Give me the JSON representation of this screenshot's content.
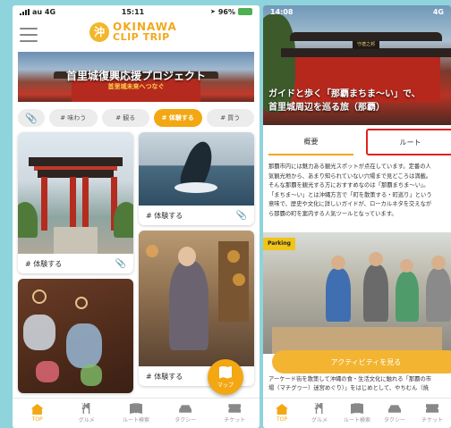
{
  "left": {
    "status": {
      "carrier": "au 4G",
      "time": "15:11",
      "battery": "96%"
    },
    "logo": {
      "line1": "OKINAWA",
      "line2": "CLIP TRIP",
      "mark": "沖"
    },
    "banner": {
      "title": "首里城復興応援プロジェクト",
      "subtitle": "首里城未来へつなぐ"
    },
    "tabs": [
      {
        "label": "📎",
        "icon": "clip-icon"
      },
      {
        "label": "# 味わう"
      },
      {
        "label": "# 観る"
      },
      {
        "label": "# 体験する",
        "active": true
      },
      {
        "label": "# 買う"
      }
    ],
    "cards": [
      {
        "tag": "# 体験する"
      },
      {
        "tag": "# 体験する"
      },
      {
        "tag": "# 体験する"
      }
    ],
    "map_button": "マップ",
    "nav": [
      {
        "label": "TOP",
        "icon": "home-icon",
        "active": true
      },
      {
        "label": "グルメ",
        "icon": "fork-icon"
      },
      {
        "label": "ルート検索",
        "icon": "book-icon"
      },
      {
        "label": "タクシー",
        "icon": "car-icon"
      },
      {
        "label": "チケット",
        "icon": "ticket-icon"
      }
    ]
  },
  "right": {
    "status": {
      "time": "14:08",
      "network": "4G"
    },
    "hero": {
      "line1": "ガイドと歩く「那覇まちま〜い」で、",
      "line2": "首里城周辺を巡る旅（那覇）",
      "sign": "守禮之邦"
    },
    "segments": {
      "overview": "概要",
      "route": "ルート"
    },
    "description": [
      "那覇市内には魅力ある観光スポットが点在しています。定番の人",
      "気観光地から、あまり知られていない穴場まで見どころは満載。",
      "そんな那覇を観光する方におすすめなのは「那覇まちま〜い」。",
      "「まちま〜い」とは沖縄方言で「町を散策する・町巡り」という",
      "意味で、歴史や文化に詳しいガイドが、ローカルネタを交えなが",
      "ら那覇の町を案内する人気ツールとなっています。"
    ],
    "photo_sign": "Parking",
    "cta": "アクティビティを見る",
    "description2": [
      "アーケード街を散策して沖縄の食・生活文化に触れる「那覇の市",
      "場（マチグヮー）迷宮めぐり）」をはじめとして、やちむん（焼"
    ],
    "nav": [
      {
        "label": "TOP",
        "icon": "home-icon",
        "active": true
      },
      {
        "label": "グルメ",
        "icon": "fork-icon"
      },
      {
        "label": "ルート検索",
        "icon": "book-icon"
      },
      {
        "label": "タクシー",
        "icon": "car-icon"
      },
      {
        "label": "チケット",
        "icon": "ticket-icon"
      }
    ]
  }
}
